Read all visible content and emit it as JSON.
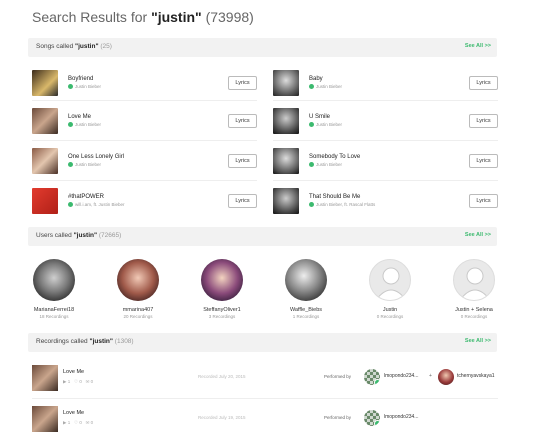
{
  "title": {
    "prefix": "Search Results for ",
    "query": "\"justin\"",
    "count": "(73998)"
  },
  "songs_section": {
    "label_prefix": "Songs called ",
    "label_query": "\"justin\"",
    "count": "(25)",
    "see_all": "See All >>"
  },
  "songs": [
    {
      "title": "Boyfriend",
      "artist": "Justin Bieber",
      "button": "Lyrics"
    },
    {
      "title": "Baby",
      "artist": "Justin Bieber",
      "button": "Lyrics"
    },
    {
      "title": "Love Me",
      "artist": "Justin Bieber",
      "button": "Lyrics"
    },
    {
      "title": "U Smile",
      "artist": "Justin Bieber",
      "button": "Lyrics"
    },
    {
      "title": "One Less Lonely Girl",
      "artist": "Justin Bieber",
      "button": "Lyrics"
    },
    {
      "title": "Somebody To Love",
      "artist": "Justin Bieber",
      "button": "Lyrics"
    },
    {
      "title": "#thatPOWER",
      "artist": "will.i.am, ft. Justin Bieber",
      "button": "Lyrics"
    },
    {
      "title": "That Should Be Me",
      "artist": "Justin Bieber, ft. Rascal Flatts",
      "button": "Lyrics"
    }
  ],
  "users_section": {
    "label_prefix": "Users called ",
    "label_query": "\"justin\"",
    "count": "(72665)",
    "see_all": "See All >>"
  },
  "users": [
    {
      "name": "MarianaFerrei18",
      "recordings": "18 Recordings"
    },
    {
      "name": "mmarina407",
      "recordings": "20 Recordings"
    },
    {
      "name": "SteffanyOliver1",
      "recordings": "3 Recordings"
    },
    {
      "name": "Waffle_Biebs",
      "recordings": "1 Recordings"
    },
    {
      "name": "Justin",
      "recordings": "0 Recordings"
    },
    {
      "name": "Justin + Selena",
      "recordings": "0 Recordings"
    }
  ],
  "recordings_section": {
    "label_prefix": "Recordings called ",
    "label_query": "\"justin\"",
    "count": "(1308)",
    "see_all": "See All >>"
  },
  "recordings": [
    {
      "title": "Love Me",
      "plays": "1",
      "loves": "0",
      "comments": "0",
      "date": "Recorded July 20, 2015",
      "performed_by": "Performed by",
      "performer": "lmopondo234...",
      "plus": "+",
      "performer2": "tchernyavskaya1"
    },
    {
      "title": "Love Me",
      "plays": "1",
      "loves": "0",
      "comments": "0",
      "date": "Recorded July 19, 2015",
      "performed_by": "Performed by",
      "performer": "lmopondo234...",
      "plus": "",
      "performer2": ""
    }
  ],
  "icons": {
    "verified": "check-badge-icon",
    "play": "play-icon",
    "heart": "heart-icon",
    "comment": "comment-icon",
    "default_avatar": "user-icon"
  },
  "colors": {
    "accent": "#3cba6f"
  }
}
